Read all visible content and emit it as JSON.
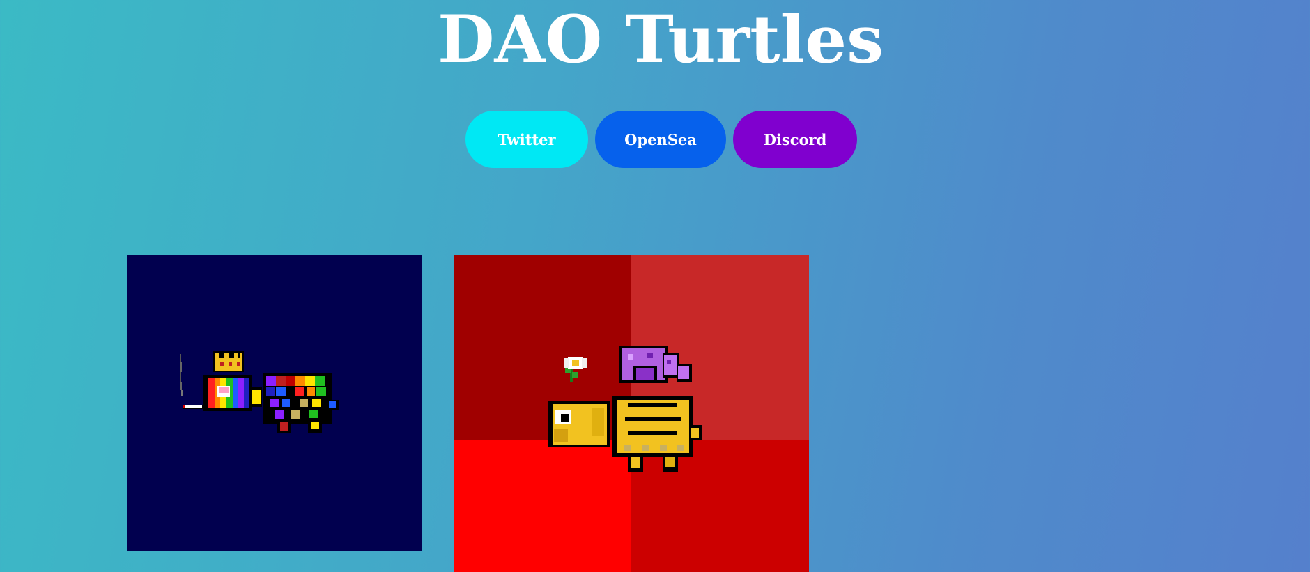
{
  "page": {
    "title": "DAO Turtles"
  },
  "buttons": [
    {
      "key": "twitter",
      "label": "Twitter",
      "color": "#00e8f4"
    },
    {
      "key": "opensea",
      "label": "OpenSea",
      "color": "#0661ec"
    },
    {
      "key": "discord",
      "label": "Discord",
      "color": "#8000cf"
    }
  ],
  "gallery": {
    "items": [
      {
        "subject": "pixel turtle with crown, rainbow head and cigarette",
        "background": "#01004f"
      },
      {
        "subject": "pixel turtle with yellow head, flower and purple hat",
        "background": [
          "#a00000",
          "#c82828",
          "#ff0000",
          "#cc0000"
        ]
      }
    ]
  }
}
